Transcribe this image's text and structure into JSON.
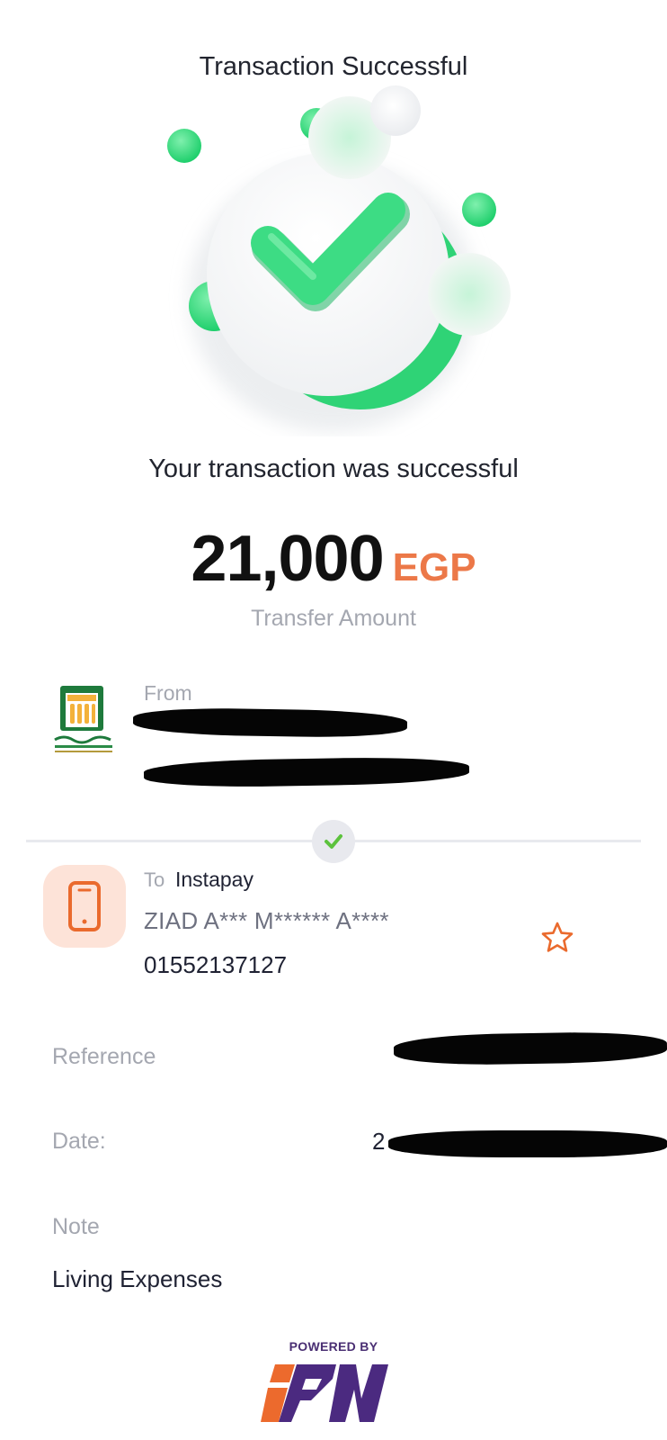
{
  "header": {
    "title": "Transaction Successful"
  },
  "hero": {
    "icon": "success-checkmark-illustration",
    "accent_color": "#2ecc71"
  },
  "status": {
    "message": "Your transaction was successful"
  },
  "amount": {
    "value": "21,000",
    "currency": "EGP",
    "label": "Transfer Amount",
    "currency_color": "#ec7848"
  },
  "from": {
    "label": "From",
    "bank_icon": "national-bank-of-egypt-logo"
  },
  "to": {
    "label": "To",
    "provider": "Instapay",
    "recipient_name": "ZIAD A*** M****** A****",
    "recipient_phone": "01552137127",
    "icon": "smartphone-icon",
    "favorite_icon": "star-outline-icon"
  },
  "details": {
    "reference_label": "Reference",
    "date_label": "Date:",
    "date_value_partial": "2",
    "note_label": "Note",
    "note_value": "Living Expenses"
  },
  "footer": {
    "powered_by": "POWERED BY",
    "brand": "IPN"
  }
}
